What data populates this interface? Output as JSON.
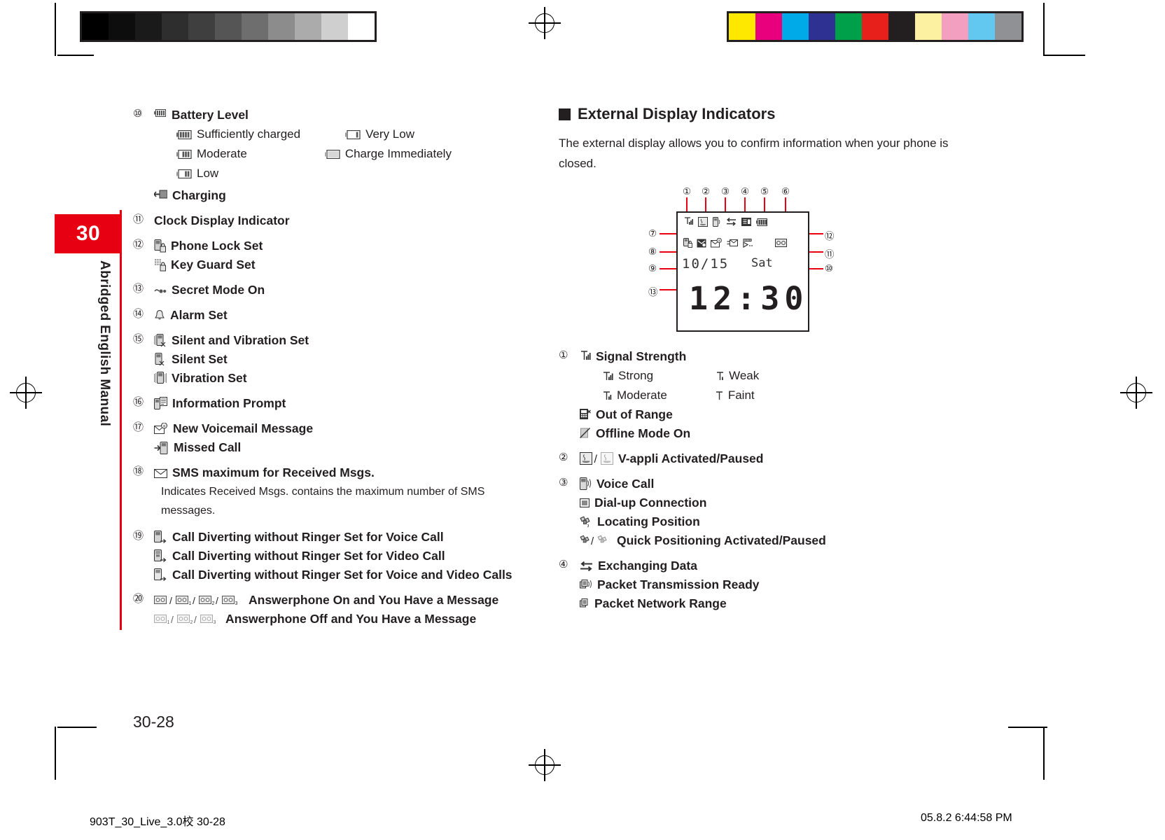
{
  "page": {
    "tab_number": "30",
    "tab_label": "Abridged English Manual",
    "page_number": "30-28",
    "footer_left": "903T_30_Live_3.0校   30-28",
    "footer_right": "05.8.2   6:44:58 PM",
    "accent_color": "#e60012"
  },
  "left_column": {
    "items": [
      {
        "num": "⑩",
        "icon": "battery-level-icon",
        "label": "Battery Level",
        "sub_pairs": [
          {
            "left_icon": "battery-full-icon",
            "left": "Sufficiently charged",
            "right_icon": "battery-very-low-icon",
            "right": "Very Low"
          },
          {
            "left_icon": "battery-moderate-icon",
            "left": "Moderate",
            "right_icon": "battery-empty-icon",
            "right": "Charge Immediately"
          },
          {
            "left_icon": "battery-low-icon",
            "left": "Low",
            "right_icon": "",
            "right": ""
          }
        ],
        "extra": {
          "icon": "charging-icon",
          "label": "Charging"
        }
      },
      {
        "num": "⑪",
        "icon": "",
        "label": "Clock Display Indicator"
      },
      {
        "num": "⑫",
        "icon": "phone-lock-icon",
        "label": "Phone Lock Set",
        "subs": [
          {
            "icon": "key-guard-icon",
            "label": "Key Guard Set"
          }
        ]
      },
      {
        "num": "⑬",
        "icon": "secret-mode-icon",
        "label": "Secret Mode On"
      },
      {
        "num": "⑭",
        "icon": "alarm-bell-icon",
        "label": "Alarm Set"
      },
      {
        "num": "⑮",
        "icon": "silent-vibration-icon",
        "label": "Silent and Vibration Set",
        "subs": [
          {
            "icon": "silent-icon",
            "label": "Silent Set"
          },
          {
            "icon": "vibration-icon",
            "label": "Vibration Set"
          }
        ]
      },
      {
        "num": "⑯",
        "icon": "information-prompt-icon",
        "label": "Information Prompt"
      },
      {
        "num": "⑰",
        "icon": "new-voicemail-icon",
        "label": "New Voicemail Message",
        "subs": [
          {
            "icon": "missed-call-icon",
            "label": "Missed Call"
          }
        ]
      },
      {
        "num": "⑱",
        "icon": "sms-max-icon",
        "label": "SMS maximum for Received Msgs.",
        "note": "Indicates Received Msgs. contains the maximum number of SMS messages."
      },
      {
        "num": "⑲",
        "icon": "divert-voice-icon",
        "label": "Call Diverting without Ringer Set for Voice Call",
        "subs": [
          {
            "icon": "divert-video-icon",
            "label": "Call Diverting without Ringer Set for Video Call"
          },
          {
            "icon": "divert-both-icon",
            "label": "Call Diverting without Ringer Set for Voice and Video Calls"
          }
        ]
      },
      {
        "num": "⑳",
        "icon": "answerphone-on-icons",
        "label": "Answerphone On and You Have a Message",
        "subs": [
          {
            "icon": "answerphone-off-icons",
            "label": "Answerphone Off and You Have a Message"
          }
        ]
      }
    ]
  },
  "right_column": {
    "heading": "External Display Indicators",
    "intro": "The external display allows you to confirm information when your phone is closed.",
    "figure": {
      "callouts_top": [
        "①",
        "②",
        "③",
        "④",
        "⑤",
        "⑥"
      ],
      "callouts_left": [
        "⑦",
        "⑧",
        "⑨",
        "⑬"
      ],
      "callouts_right": [
        "⑫",
        "⑪",
        "⑩"
      ],
      "date": "10/15",
      "day": "Sat",
      "time": "12:30"
    },
    "items": [
      {
        "num": "①",
        "icon": "signal-strength-icon",
        "label": "Signal Strength",
        "sub_pairs": [
          {
            "left_icon": "signal-strong-icon",
            "left": "Strong",
            "right_icon": "signal-weak-icon",
            "right": "Weak"
          },
          {
            "left_icon": "signal-moderate-icon",
            "left": "Moderate",
            "right_icon": "signal-faint-icon",
            "right": "Faint"
          }
        ],
        "subs": [
          {
            "icon": "out-of-range-icon",
            "label": "Out of Range"
          },
          {
            "icon": "offline-mode-icon",
            "label": "Offline Mode On"
          }
        ]
      },
      {
        "num": "②",
        "icon": "v-appli-icons",
        "label": "V-appli Activated/Paused"
      },
      {
        "num": "③",
        "icon": "voice-call-icon",
        "label": "Voice Call",
        "subs": [
          {
            "icon": "dial-up-icon",
            "label": "Dial-up Connection"
          },
          {
            "icon": "locating-position-icon",
            "label": "Locating Position"
          },
          {
            "icon": "quick-positioning-icons",
            "label": "Quick Positioning Activated/Paused"
          }
        ]
      },
      {
        "num": "④",
        "icon": "exchanging-data-icon",
        "label": "Exchanging Data",
        "subs": [
          {
            "icon": "packet-ready-icon",
            "label": "Packet Transmission Ready"
          },
          {
            "icon": "packet-range-icon",
            "label": "Packet Network Range"
          }
        ]
      }
    ]
  },
  "calibration": {
    "gray_swatches": [
      "#000000",
      "#0d0d0d",
      "#1a1a1a",
      "#2e2e2e",
      "#3f3f3f",
      "#555555",
      "#6e6e6e",
      "#8c8c8c",
      "#ababab",
      "#cfcfcf",
      "#ffffff"
    ],
    "color_swatches": [
      "#ffe800",
      "#e8007d",
      "#00a9e8",
      "#2e3192",
      "#00a04a",
      "#e8201c",
      "#231f20",
      "#fcf1a0",
      "#f3a0c0",
      "#63c8f0",
      "#8f9194"
    ]
  }
}
